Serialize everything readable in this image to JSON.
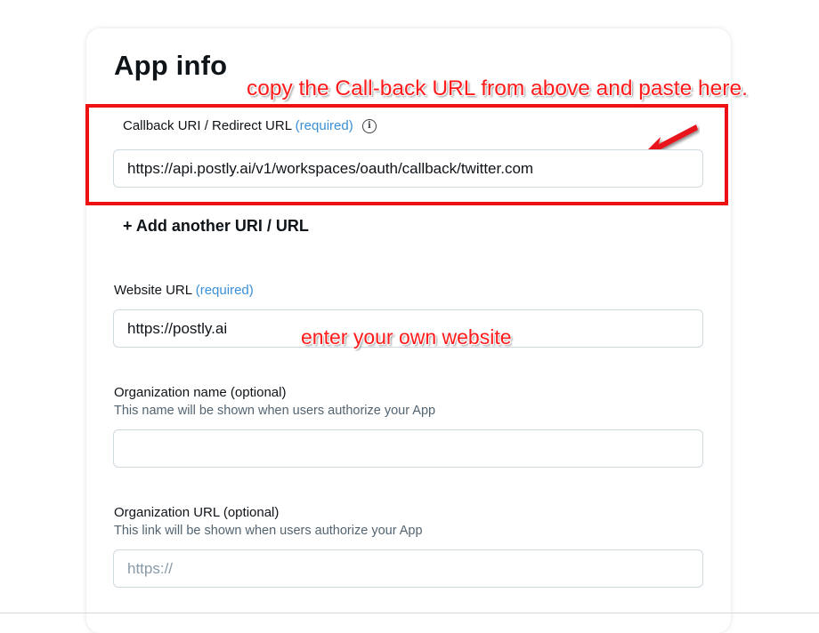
{
  "page": {
    "title": "App info"
  },
  "annotations": {
    "callback_note": "copy the Call-back URL from above and paste here.",
    "website_note": "enter your own website"
  },
  "callback": {
    "label": "Callback URI / Redirect URL",
    "required": "(required)",
    "info_icon": "i",
    "value": "https://api.postly.ai/v1/workspaces/oauth/callback/twitter.com",
    "add_another": "+ Add another URI / URL"
  },
  "website": {
    "label": "Website URL",
    "required": "(required)",
    "value": "https://postly.ai"
  },
  "organization_name": {
    "label": "Organization name",
    "optional": "(optional)",
    "hint": "This name will be shown when users authorize your App",
    "value": ""
  },
  "organization_url": {
    "label": "Organization URL",
    "optional": "(optional)",
    "hint": "This link will be shown when users authorize your App",
    "placeholder": "https://",
    "value": ""
  },
  "colors": {
    "annotation_red": "#ff1b1b",
    "required_blue": "#3a8fd6",
    "border": "#cfd9de"
  }
}
